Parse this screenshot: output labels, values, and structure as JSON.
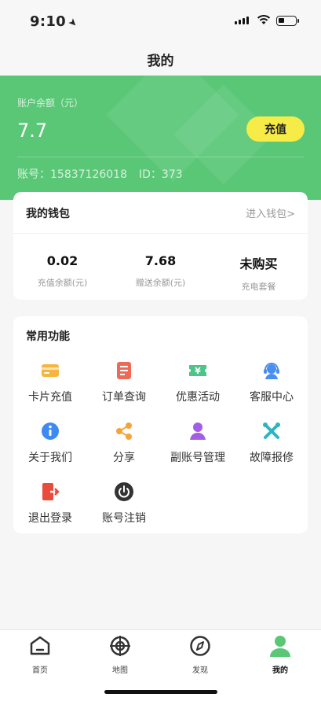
{
  "status_bar": {
    "time": "9:10"
  },
  "nav": {
    "title": "我的"
  },
  "account": {
    "balance_label": "账户余额（元）",
    "balance_value": "7.7",
    "recharge_label": "充值",
    "account_number": "账号：15837126018",
    "account_id": "ID：373"
  },
  "wallet": {
    "title": "我的钱包",
    "link": "进入钱包>",
    "stats": [
      {
        "value": "0.02",
        "label": "充值余额(元)"
      },
      {
        "value": "7.68",
        "label": "赠送余额(元)"
      },
      {
        "value": "未购买",
        "label": "充电套餐"
      }
    ]
  },
  "functions": {
    "title": "常用功能",
    "items": [
      {
        "label": "卡片充值",
        "icon": "card-icon",
        "color": "#f5b53f"
      },
      {
        "label": "订单查询",
        "icon": "order-document-icon",
        "color": "#ee6a56"
      },
      {
        "label": "优惠活动",
        "icon": "coupon-yen-icon",
        "color": "#4cc48a"
      },
      {
        "label": "客服中心",
        "icon": "customer-service-icon",
        "color": "#4a8ff0"
      },
      {
        "label": "关于我们",
        "icon": "info-icon",
        "color": "#3d8af2"
      },
      {
        "label": "分享",
        "icon": "share-icon",
        "color": "#f4a43a"
      },
      {
        "label": "副账号管理",
        "icon": "sub-account-icon",
        "color": "#a35de6"
      },
      {
        "label": "故障报修",
        "icon": "repair-tools-icon",
        "color": "#2cb4c2"
      },
      {
        "label": "退出登录",
        "icon": "logout-icon",
        "color": "#e94b3c"
      },
      {
        "label": "账号注销",
        "icon": "power-icon",
        "color": "#333333"
      }
    ]
  },
  "tabs": [
    {
      "label": "首页",
      "icon": "home-icon"
    },
    {
      "label": "地图",
      "icon": "map-target-icon"
    },
    {
      "label": "发现",
      "icon": "compass-icon"
    },
    {
      "label": "我的",
      "icon": "user-icon",
      "active": true
    }
  ],
  "colors": {
    "brand_green": "#5ac777",
    "recharge_yellow": "#f7eb48",
    "battery_level": 0.35
  }
}
